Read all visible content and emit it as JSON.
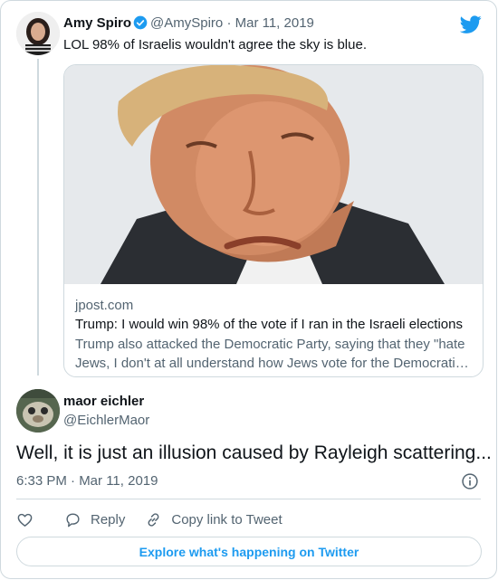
{
  "original_tweet": {
    "display_name": "Amy Spiro",
    "handle": "@AmySpiro",
    "separator": "·",
    "date": "Mar 11, 2019",
    "text": "LOL 98% of Israelis wouldn't agree the sky is blue."
  },
  "link_card": {
    "domain": "jpost.com",
    "title": "Trump: I would win 98% of the vote if I ran in the Israeli elections",
    "description": "Trump also attacked the Democratic Party, saying that they \"hate Jews, I don't at all understand how Jews vote for the Democrati…"
  },
  "reply_tweet": {
    "display_name": "maor eichler",
    "handle": "@EichlerMaor",
    "text": "Well, it is just an illusion caused by Rayleigh scattering...",
    "timestamp": "6:33 PM · Mar 11, 2019"
  },
  "actions": {
    "reply_label": "Reply",
    "copy_label": "Copy link to Tweet"
  },
  "explore_label": "Explore what's happening on Twitter",
  "colors": {
    "accent": "#1d9bf0",
    "muted": "#536471",
    "border": "#cfd9de"
  },
  "icons": {
    "brand": "twitter-bird-icon",
    "verified": "verified-badge-icon",
    "info": "info-icon",
    "like": "heart-icon",
    "reply": "speech-bubble-icon",
    "copy": "link-icon"
  }
}
